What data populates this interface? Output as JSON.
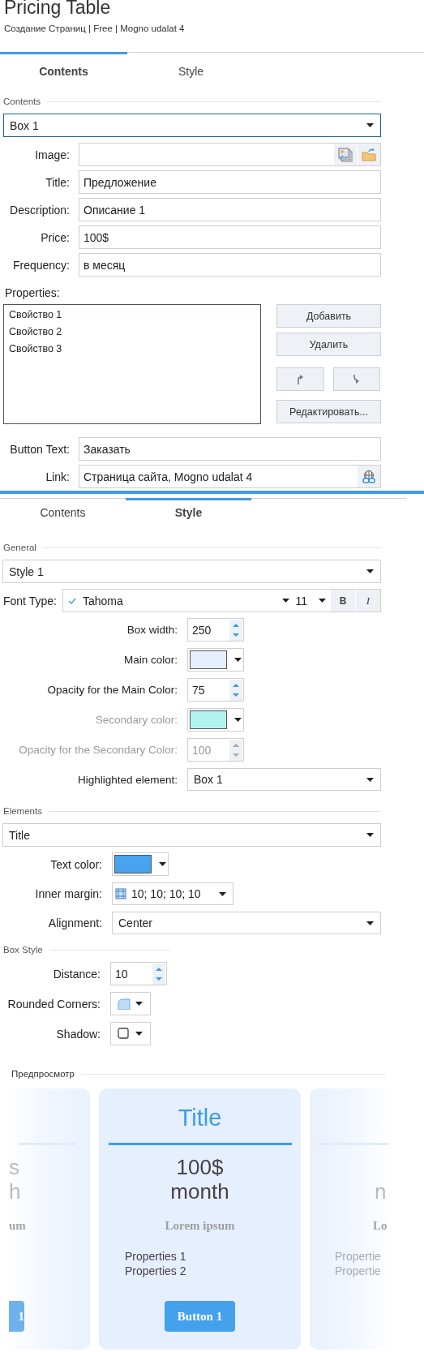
{
  "header": {
    "title": "Pricing Table",
    "subtitle": "Создание Страниц | Free | Mogno udalat 4"
  },
  "contents_panel": {
    "tabs": [
      {
        "label": "Contents",
        "selected": true
      },
      {
        "label": "Style",
        "selected": false
      }
    ],
    "section_label": "Contents",
    "box_select": "Box 1",
    "fields": [
      {
        "kind": "image",
        "label": "Image:"
      },
      {
        "kind": "text",
        "label": "Title:",
        "value": "Предложение"
      },
      {
        "kind": "text",
        "label": "Description:",
        "value": "Описание 1"
      },
      {
        "kind": "text",
        "label": "Price:",
        "value": "100$"
      },
      {
        "kind": "text",
        "label": "Frequency:",
        "value": "в месяц"
      }
    ],
    "properties": {
      "label": "Properties:",
      "items": [
        "Свойство 1",
        "Свойство 2",
        "Свойство 3"
      ],
      "buttons": [
        {
          "kind": "text",
          "label": "Добавить"
        },
        {
          "kind": "text",
          "label": "Удалить"
        },
        {
          "kind": "up"
        },
        {
          "kind": "down"
        },
        {
          "kind": "text",
          "label": "Редактировать..."
        }
      ]
    },
    "bottom_fields": [
      {
        "kind": "text",
        "label": "Button Text:",
        "value": "Заказать"
      },
      {
        "kind": "link",
        "label": "Link:",
        "value": "Страница сайта, Mogno udalat 4"
      }
    ]
  },
  "style_panel": {
    "tabs": [
      {
        "label": "Contents",
        "selected": false
      },
      {
        "label": "Style",
        "selected": true
      }
    ],
    "general": {
      "label": "General",
      "style_select": "Style 1",
      "font_label": "Font Type:",
      "font_family": "Tahoma",
      "font_size": "11",
      "bold_button": "B",
      "italic_button": "I",
      "rows": [
        {
          "kind": "spinner",
          "label": "Box width:",
          "value": "250",
          "disabled": false
        },
        {
          "kind": "color",
          "label": "Main color:",
          "color": "#e6efff",
          "disabled": false
        },
        {
          "kind": "spinner",
          "label": "Opacity for the Main Color:",
          "value": "75",
          "disabled": false
        },
        {
          "kind": "color",
          "label": "Secondary color:",
          "color": "#b3f3ef",
          "disabled": true
        },
        {
          "kind": "spinner",
          "label": "Opacity for the Secondary Color:",
          "value": "100",
          "disabled": true
        },
        {
          "kind": "dropdown",
          "label": "Highlighted element:",
          "value": "Box 1",
          "disabled": false
        }
      ]
    },
    "elements": {
      "label": "Elements",
      "element_select": "Title",
      "rows": [
        {
          "kind": "color",
          "label": "Text color:",
          "color": "#47a3ee",
          "disabled": false
        },
        {
          "kind": "margin",
          "label": "Inner margin:",
          "value": "10; 10; 10; 10",
          "disabled": false
        },
        {
          "kind": "dropdown",
          "label": "Alignment:",
          "value": "Center",
          "disabled": false
        }
      ]
    },
    "box_style": {
      "label": "Box Style",
      "rows": [
        {
          "kind": "spinner",
          "label": "Distance:",
          "value": "10",
          "disabled": false
        },
        {
          "kind": "corners",
          "label": "Rounded Corners:",
          "disabled": false
        },
        {
          "kind": "shadow",
          "label": "Shadow:",
          "disabled": false
        }
      ]
    }
  },
  "preview": {
    "label": "Предпросмотр",
    "cards": [
      {
        "kind": "left",
        "price": "s",
        "frequency": "h",
        "description": "um",
        "button": "1"
      },
      {
        "kind": "center",
        "title": "Title",
        "price": "100$",
        "frequency": "month",
        "description": "Lorem ipsum",
        "properties": [
          "Properties 1",
          "Properties 2"
        ],
        "button": "Button 1"
      },
      {
        "kind": "right",
        "frequency": "n",
        "description": "Lo",
        "properties": [
          "Propertie",
          "Propertie"
        ]
      }
    ]
  }
}
